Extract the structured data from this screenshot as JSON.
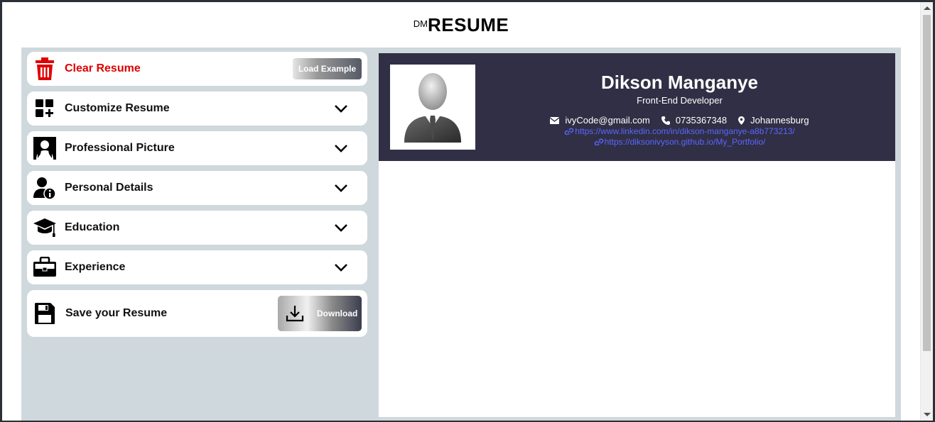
{
  "header": {
    "logo_prefix": "DM",
    "logo_main": "RESUME"
  },
  "panel": {
    "clear": {
      "label": "Clear Resume",
      "load_example": "Load Example"
    },
    "sections": [
      {
        "label": "Customize Resume",
        "icon": "customize-icon"
      },
      {
        "label": "Professional Picture",
        "icon": "portrait-icon"
      },
      {
        "label": "Personal Details",
        "icon": "person-info-icon"
      },
      {
        "label": "Education",
        "icon": "graduation-cap-icon"
      },
      {
        "label": "Experience",
        "icon": "briefcase-icon"
      }
    ],
    "save": {
      "label": "Save your Resume",
      "download": "Download"
    }
  },
  "resume": {
    "name": "Dikson Manganye",
    "role": "Front-End Developer",
    "email": "ivyCode@gmail.com",
    "phone": "0735367348",
    "location": "Johannesburg",
    "links": [
      "https://www.linkedin.com/in/dikson-manganye-a8b773213/",
      "https://diksonivyson.github.io/My_Portfolio/"
    ]
  },
  "colors": {
    "accent_red": "#e00000",
    "resume_header_bg": "#302f45",
    "panel_bg": "#cfd8dc",
    "link": "#5a66ff"
  }
}
